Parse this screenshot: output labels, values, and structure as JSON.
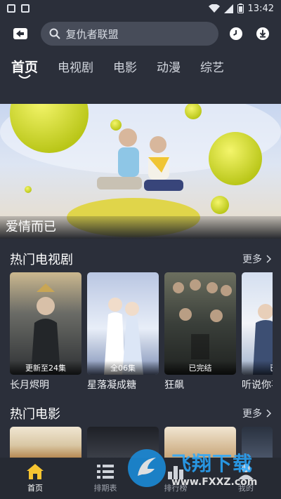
{
  "status_bar": {
    "time": "13:42"
  },
  "header": {
    "search_placeholder": "复仇者联盟"
  },
  "tabs": [
    "首页",
    "电视剧",
    "电影",
    "动漫",
    "综艺"
  ],
  "banner": {
    "caption": "爱情而已"
  },
  "sections": {
    "tv": {
      "title": "热门电视剧",
      "more": "更多",
      "items": [
        {
          "title": "长月烬明",
          "badge": "更新至24集",
          "colors": [
            "#5a5f62",
            "#2e3134",
            "#cbb88f"
          ]
        },
        {
          "title": "星落凝成糖",
          "badge": "全06集",
          "colors": [
            "#b9c6e2",
            "#e8eef8",
            "#7e8fb5"
          ]
        },
        {
          "title": "狂飙",
          "badge": "已完结",
          "colors": [
            "#3a3f3a",
            "#1f2220",
            "#6c6f5f"
          ]
        },
        {
          "title": "听说你喜",
          "badge": "已完",
          "colors": [
            "#d4dff0",
            "#f2f4f8",
            "#9fb0cc"
          ]
        }
      ]
    },
    "movie": {
      "title": "热门电影",
      "more": "更多",
      "items": [
        {
          "colors": [
            "#d9c7a4",
            "#b68a55"
          ]
        },
        {
          "colors": [
            "#1e2026",
            "#3b3f48"
          ]
        },
        {
          "colors": [
            "#f1e6d2",
            "#c9a77a"
          ]
        },
        {
          "colors": [
            "#2a3240",
            "#4a5568"
          ]
        }
      ]
    }
  },
  "bottom_nav": [
    {
      "label": "首页",
      "icon": "home-icon",
      "active": true
    },
    {
      "label": "排期表",
      "icon": "list-icon",
      "active": false
    },
    {
      "label": "排行榜",
      "icon": "ranking-icon",
      "active": false
    },
    {
      "label": "我的",
      "icon": "profile-icon",
      "active": false
    }
  ],
  "watermark": {
    "brand": "飞翔下载",
    "url": "www.FXXZ.com"
  },
  "colors": {
    "background": "#2b2f3a",
    "accent": "#f7c531",
    "search_bg": "#474c59"
  }
}
